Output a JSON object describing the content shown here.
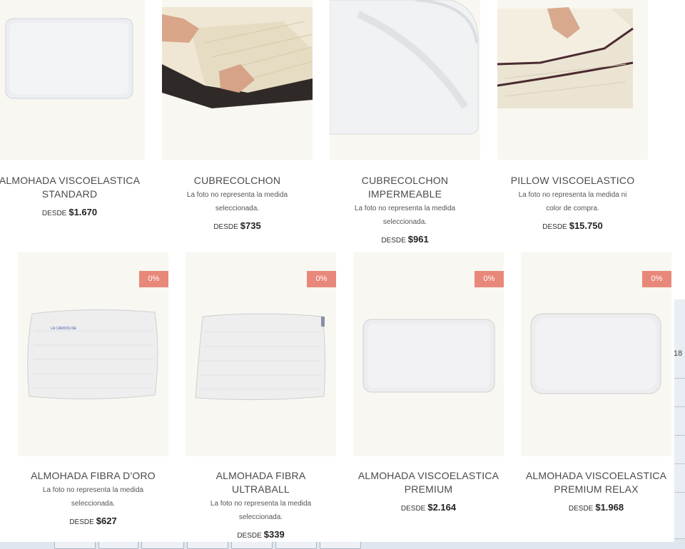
{
  "products_row1": [
    {
      "title_line1": "ALMOHADA VISCOELASTICA",
      "title_line2": "STANDARD",
      "note_line1": "",
      "note_line2": "",
      "price_prefix": "DESDE",
      "price": "$1.670"
    },
    {
      "title_line1": "CUBRECOLCHON",
      "title_line2": "",
      "note_line1": "La foto no representa la medida",
      "note_line2": "seleccionada.",
      "price_prefix": "DESDE",
      "price": "$735"
    },
    {
      "title_line1": "CUBRECOLCHON",
      "title_line2": "IMPERMEABLE",
      "note_line1": "La foto no representa la medida",
      "note_line2": "seleccionada.",
      "price_prefix": "DESDE",
      "price": "$961"
    },
    {
      "title_line1": "PILLOW VISCOELASTICO",
      "title_line2": "",
      "note_line1": "La foto no representa la medida ni",
      "note_line2": "color de compra.",
      "price_prefix": "DESDE",
      "price": "$15.750"
    }
  ],
  "products_row2": [
    {
      "badge": "0%",
      "title_line1": "ALMOHADA FIBRA D'ORO",
      "title_line2": "",
      "note_line1": "La foto no representa la medida",
      "note_line2": "seleccionada.",
      "price_prefix": "DESDE",
      "price": "$627",
      "pillow_label": "LA CARDOLISE"
    },
    {
      "badge": "0%",
      "title_line1": "ALMOHADA FIBRA",
      "title_line2": "ULTRABALL",
      "note_line1": "La foto no representa la medida",
      "note_line2": "seleccionada.",
      "price_prefix": "DESDE",
      "price": "$339"
    },
    {
      "badge": "0%",
      "title_line1": "ALMOHADA VISCOELASTICA",
      "title_line2": "PREMIUM",
      "note_line1": "",
      "note_line2": "",
      "price_prefix": "DESDE",
      "price": "$2.164"
    },
    {
      "badge": "0%",
      "title_line1": "ALMOHADA VISCOELASTICA",
      "title_line2": "PREMIUM RELAX",
      "note_line1": "",
      "note_line2": "",
      "price_prefix": "DESDE",
      "price": "$1.968"
    }
  ],
  "background_window": {
    "number_fragment": "18"
  },
  "colors": {
    "card_bg": "#f8f7f1",
    "badge": "#e8887a",
    "title": "#4a4a4a"
  }
}
